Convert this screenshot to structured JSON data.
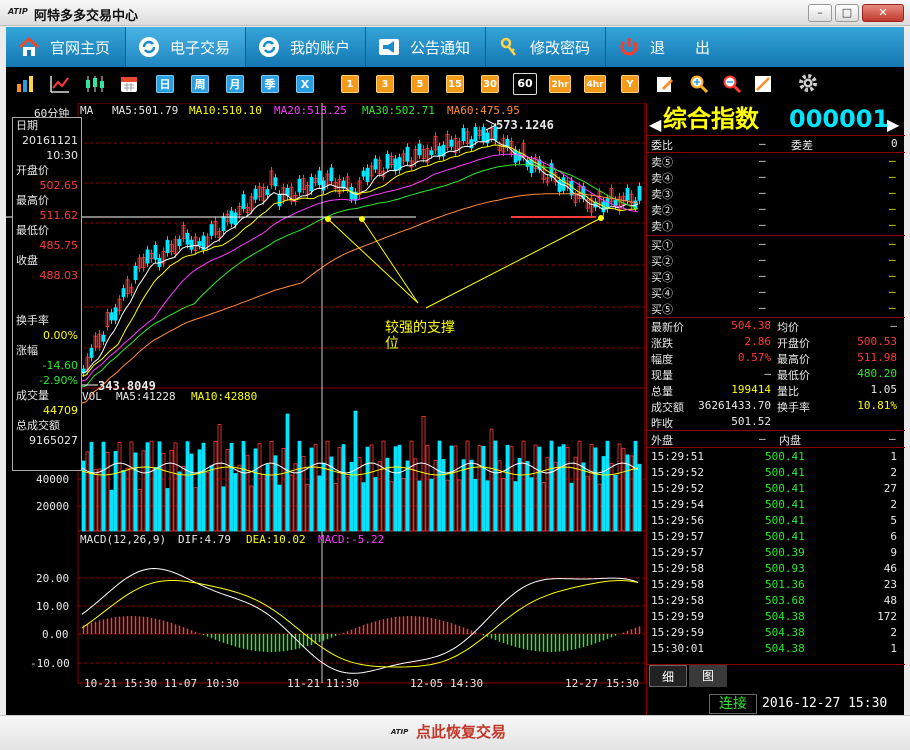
{
  "window": {
    "logo": "ATIP",
    "title": "阿特多多交易中心",
    "minimize_glyph": "–",
    "maximize_glyph": "□",
    "close_glyph": "✕"
  },
  "nav": {
    "items": [
      {
        "label": "官网主页",
        "icon": "home-icon"
      },
      {
        "label": "电子交易",
        "icon": "refresh-icon"
      },
      {
        "label": "我的账户",
        "icon": "refresh-icon"
      },
      {
        "label": "公告通知",
        "icon": "megaphone-icon"
      },
      {
        "label": "修改密码",
        "icon": "key-icon"
      },
      {
        "label": "退　　出",
        "icon": "power-icon"
      }
    ]
  },
  "toolbar": {
    "period_buttons": [
      "日",
      "周",
      "月",
      "季",
      "X"
    ],
    "minute_buttons": [
      "1",
      "3",
      "5",
      "15",
      "30",
      "60",
      "2hr",
      "4hr",
      "Y"
    ],
    "selected": "60"
  },
  "chart_header": {
    "period": "60分钟",
    "ma_label": "MA",
    "ma5": "MA5:501.79",
    "ma10": "MA10:510.10",
    "ma20": "MA20:513.25",
    "ma30": "MA30:502.71",
    "ma60": "MA60:475.95",
    "high_label": "573.1246",
    "low_label": "343.8049"
  },
  "annotation": {
    "text_line1": "较强的支撑",
    "text_line2": "位"
  },
  "info_box": {
    "date_label": "日期",
    "date": "20161121",
    "time": "10:30",
    "open_label": "开盘价",
    "open": "502.65",
    "high_label": "最高价",
    "high": "511.62",
    "low_label": "最低价",
    "low": "485.75",
    "close_label": "收盘",
    "close": "488.03",
    "turnover_label": "换手率",
    "turnover": "0.00%",
    "change_label": "涨幅",
    "change": "-14.60",
    "change_pct": "-2.90%",
    "volume_label": "成交量",
    "volume": "44709",
    "total_label": "总成交额",
    "total": "9165027"
  },
  "vol_header": {
    "vol": "VOL",
    "ma5": "MA5:41228",
    "ma10": "MA10:42880",
    "ticks": [
      "40000",
      "20000"
    ]
  },
  "macd_header": {
    "name": "MACD(12,26,9)",
    "dif": "DIF:4.79",
    "dea": "DEA:10.02",
    "macd": "MACD:-5.22",
    "ticks": [
      "20.00",
      "10.00",
      "0.00",
      "-10.00"
    ]
  },
  "x_axis": [
    "10-21",
    "15:30",
    "11-07",
    "10:30",
    "11-21",
    "11:30",
    "12-05",
    "14:30",
    "12-27",
    "15:30"
  ],
  "quote": {
    "name": "综合指数",
    "code": "000001",
    "weibi_label": "委比",
    "weibi": "—",
    "weicha_label": "委差",
    "weicha": "0",
    "sells": [
      {
        "label": "卖⑤",
        "price": "—",
        "vol": "—"
      },
      {
        "label": "卖④",
        "price": "—",
        "vol": "—"
      },
      {
        "label": "卖③",
        "price": "—",
        "vol": "—"
      },
      {
        "label": "卖②",
        "price": "—",
        "vol": "—"
      },
      {
        "label": "卖①",
        "price": "—",
        "vol": "—"
      }
    ],
    "buys": [
      {
        "label": "买①",
        "price": "—",
        "vol": "—"
      },
      {
        "label": "买②",
        "price": "—",
        "vol": "—"
      },
      {
        "label": "买③",
        "price": "—",
        "vol": "—"
      },
      {
        "label": "买④",
        "price": "—",
        "vol": "—"
      },
      {
        "label": "买⑤",
        "price": "—",
        "vol": "—"
      }
    ],
    "stats": [
      {
        "l1": "最新价",
        "v1": "504.38",
        "l2": "均价",
        "v2": "—"
      },
      {
        "l1": "涨跌",
        "v1": "2.86",
        "l2": "开盘价",
        "v2": "500.53"
      },
      {
        "l1": "幅度",
        "v1": "0.57%",
        "l2": "最高价",
        "v2": "511.98"
      },
      {
        "l1": "现量",
        "v1": "—",
        "l2": "最低价",
        "v2": "480.20"
      },
      {
        "l1": "总量",
        "v1": "199414",
        "l2": "量比",
        "v2": "1.05"
      },
      {
        "l1": "成交额",
        "v1": "36261433.70",
        "l2": "换手率",
        "v2": "10.81%"
      },
      {
        "l1": "昨收",
        "v1": "501.52",
        "l2": "",
        "v2": ""
      }
    ],
    "outer_label": "外盘",
    "outer": "—",
    "inner_label": "内盘",
    "inner": "—",
    "ticks": [
      {
        "time": "15:29:51",
        "price": "500.41",
        "vol": "1"
      },
      {
        "time": "15:29:52",
        "price": "500.41",
        "vol": "2"
      },
      {
        "time": "15:29:52",
        "price": "500.41",
        "vol": "27"
      },
      {
        "time": "15:29:54",
        "price": "500.41",
        "vol": "2"
      },
      {
        "time": "15:29:56",
        "price": "500.41",
        "vol": "5"
      },
      {
        "time": "15:29:57",
        "price": "500.41",
        "vol": "6"
      },
      {
        "time": "15:29:57",
        "price": "500.39",
        "vol": "9"
      },
      {
        "time": "15:29:58",
        "price": "500.93",
        "vol": "46"
      },
      {
        "time": "15:29:58",
        "price": "501.36",
        "vol": "23"
      },
      {
        "time": "15:29:58",
        "price": "503.68",
        "vol": "48"
      },
      {
        "time": "15:29:59",
        "price": "504.38",
        "vol": "172"
      },
      {
        "time": "15:29:59",
        "price": "504.38",
        "vol": "2"
      },
      {
        "time": "15:30:01",
        "price": "504.38",
        "vol": "1"
      }
    ],
    "tab_detail": "细",
    "tab_chart": "图",
    "connect": "连接",
    "datetime": "2016-12-27  15:30"
  },
  "bottom": {
    "logo": "ATIP",
    "restore_text": "点此恢复交易"
  },
  "colors": {
    "up": "#ff3a3a",
    "down": "#00e5ff",
    "ma5": "#ffffff",
    "ma10": "#ffff00",
    "ma20": "#ff3aff",
    "ma30": "#2ee82e",
    "ma60": "#ff8c3a"
  }
}
